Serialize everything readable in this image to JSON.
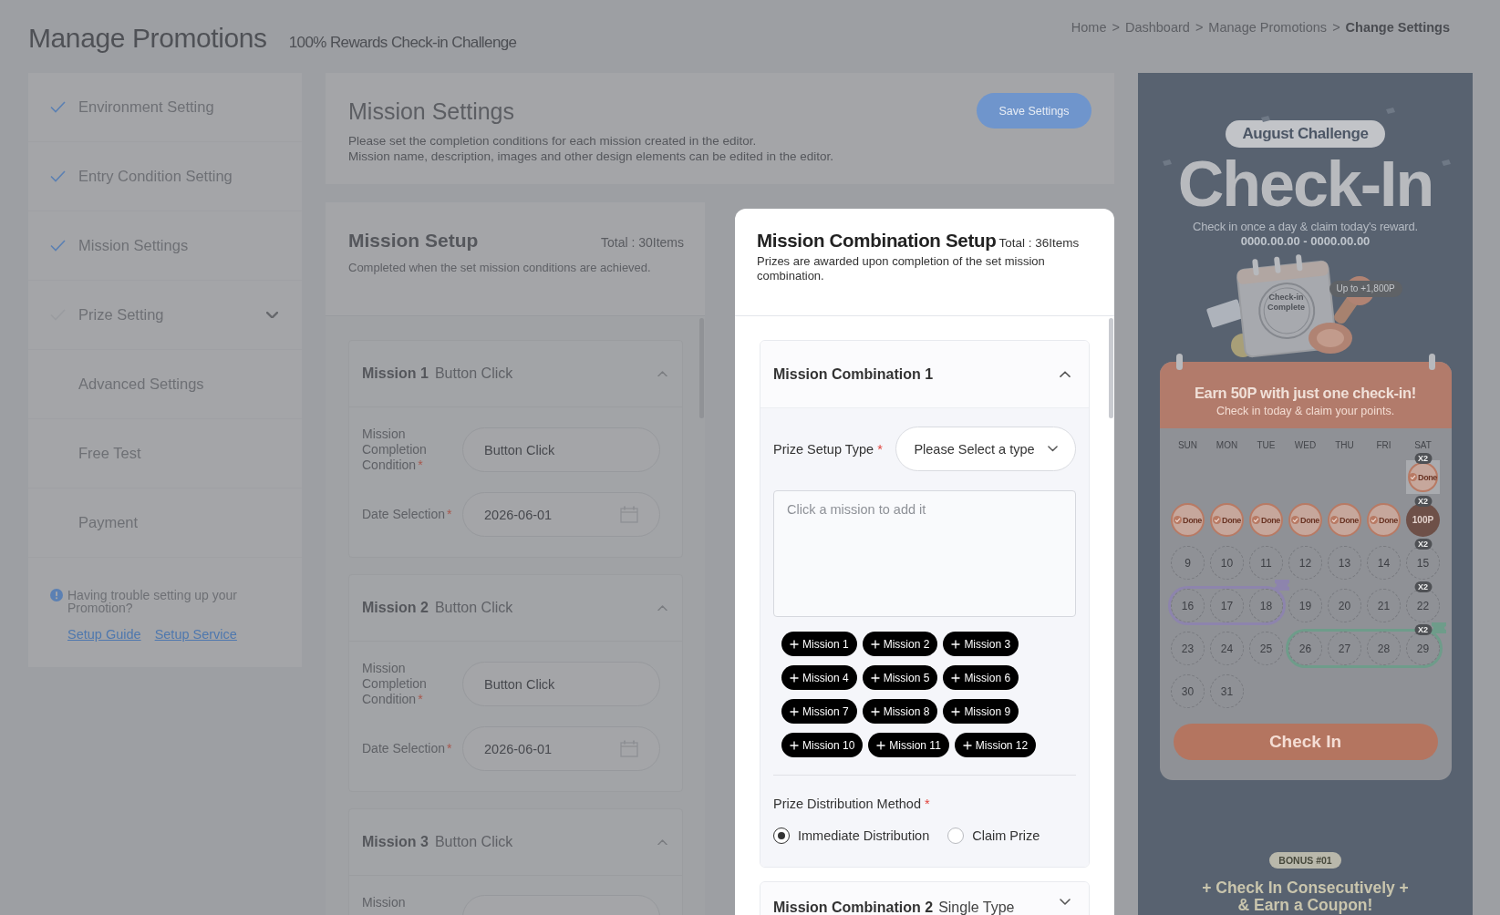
{
  "header": {
    "title": "Manage Promotions",
    "subtitle": "100% Rewards Check-in Challenge",
    "breadcrumb": [
      {
        "label": "Home",
        "kind": "link"
      },
      {
        "label": ">",
        "kind": "separator"
      },
      {
        "label": "Dashboard",
        "kind": "link"
      },
      {
        "label": ">",
        "kind": "separator"
      },
      {
        "label": "Manage Promotions",
        "kind": "link"
      },
      {
        "label": ">",
        "kind": "separator"
      },
      {
        "label": "Change Settings",
        "kind": "current"
      }
    ]
  },
  "sidebar": {
    "items": [
      {
        "label": "Environment Setting",
        "kind": "step",
        "completed": true,
        "in_progress": false
      },
      {
        "label": "Entry Condition Setting",
        "kind": "step",
        "completed": true,
        "in_progress": false
      },
      {
        "label": "Mission Settings",
        "kind": "step",
        "completed": true,
        "in_progress": false
      },
      {
        "label": "Prize Setting",
        "kind": "group",
        "completed": false,
        "in_progress": true,
        "expanded": false
      },
      {
        "label": "Advanced Settings",
        "kind": "step",
        "completed": false,
        "in_progress": false
      },
      {
        "label": "Free Test",
        "kind": "step",
        "completed": false,
        "in_progress": false
      },
      {
        "label": "Payment",
        "kind": "step",
        "completed": false,
        "in_progress": false
      }
    ],
    "help": {
      "text": "Having trouble setting up your Promotion?",
      "links": [
        "Setup Guide",
        "Setup Service"
      ]
    }
  },
  "settings": {
    "title": "Mission Settings",
    "description": [
      "Please set the completion conditions for each mission created in the editor.",
      "Mission name, description, images and other design elements can be edited in the editor."
    ],
    "save_button": "Save Settings"
  },
  "mission_setup": {
    "title": "Mission Setup",
    "total": "Total : 30Items",
    "description": "Completed when the set mission conditions are achieved.",
    "missions": [
      {
        "number": "Mission 1",
        "type": "Button Click",
        "expanded": true,
        "fields": [
          {
            "kind": "text",
            "label": "Mission Completion Condition",
            "required_mark": "*",
            "value": "Button Click"
          },
          {
            "kind": "date",
            "label": "Date Selection",
            "required_mark": "*",
            "value": "2026-06-01"
          }
        ]
      },
      {
        "number": "Mission 2",
        "type": "Button Click",
        "expanded": true,
        "fields": [
          {
            "kind": "text",
            "label": "Mission Completion Condition",
            "required_mark": "*",
            "value": "Button Click"
          },
          {
            "kind": "date",
            "label": "Date Selection",
            "required_mark": "*",
            "value": "2026-06-01"
          }
        ]
      },
      {
        "number": "Mission 3",
        "type": "Button Click",
        "expanded": true,
        "fields": [
          {
            "kind": "text",
            "label": "Mission"
          }
        ]
      }
    ]
  },
  "combination_setup": {
    "title": "Mission Combination Setup",
    "total": "Total : 36Items",
    "description": "Prizes are awarded upon completion of the set mission combination.",
    "combinations": [
      {
        "title": "Mission Combination 1",
        "expanded": true,
        "prize_type": {
          "label": "Prize Setup Type",
          "required_mark": "*",
          "value": "Please Select a type"
        },
        "missions_field": {
          "placeholder": "Click a mission to add it"
        },
        "mission_chips": [
          "Mission 1",
          "Mission 2",
          "Mission 3",
          "Mission 4",
          "Mission 5",
          "Mission 6",
          "Mission 7",
          "Mission 8",
          "Mission 9",
          "Mission 10",
          "Mission 11",
          "Mission 12"
        ],
        "distribution": {
          "label": "Prize Distribution Method",
          "required_mark": "*",
          "options": [
            {
              "label": "Immediate Distribution",
              "selected": true
            },
            {
              "label": "Claim Prize",
              "selected": false
            }
          ]
        }
      },
      {
        "title": "Mission Combination 2",
        "type": "Single Type",
        "expanded": false
      }
    ]
  },
  "preview": {
    "badge": "August Challenge",
    "title": "Check-In",
    "subtitle": "Check in once a day & claim today's reward.",
    "period": "0000.00.00 - 0000.00.00",
    "illustration_text": "Check-in Complete",
    "reward_tag": "Up to +1,800P",
    "calendar": {
      "headline": "Earn 50P with just one check-in!",
      "subline": "Check in today & claim your points.",
      "weekdays": [
        "SUN",
        "MON",
        "TUE",
        "WED",
        "THU",
        "FRI",
        "SAT"
      ],
      "weeks": [
        [
          {
            "kind": "empty"
          },
          {
            "kind": "empty"
          },
          {
            "kind": "empty"
          },
          {
            "kind": "empty"
          },
          {
            "kind": "empty"
          },
          {
            "kind": "empty"
          },
          {
            "kind": "sticker",
            "label": "Done",
            "badge": "X2"
          }
        ],
        [
          {
            "kind": "stamp",
            "label": "Done"
          },
          {
            "kind": "stamp",
            "label": "Done"
          },
          {
            "kind": "stamp",
            "label": "Done"
          },
          {
            "kind": "stamp",
            "label": "Done"
          },
          {
            "kind": "stamp",
            "label": "Done"
          },
          {
            "kind": "stamp",
            "label": "Done"
          },
          {
            "kind": "reward",
            "label": "100P",
            "badge": "X2"
          }
        ],
        [
          {
            "kind": "day",
            "label": "9"
          },
          {
            "kind": "day",
            "label": "10"
          },
          {
            "kind": "day",
            "label": "11"
          },
          {
            "kind": "day",
            "label": "12"
          },
          {
            "kind": "day",
            "label": "13"
          },
          {
            "kind": "day",
            "label": "14"
          },
          {
            "kind": "day",
            "label": "15",
            "badge": "X2"
          }
        ],
        [
          {
            "kind": "day",
            "label": "16",
            "color": "#8d84ad"
          },
          {
            "kind": "day",
            "label": "17",
            "color": "#8d84ad"
          },
          {
            "kind": "day",
            "label": "18",
            "color": "#8d84ad"
          },
          {
            "kind": "day",
            "label": "19"
          },
          {
            "kind": "day",
            "label": "20"
          },
          {
            "kind": "day",
            "label": "21"
          },
          {
            "kind": "day",
            "label": "22",
            "badge": "X2"
          }
        ],
        [
          {
            "kind": "day",
            "label": "23"
          },
          {
            "kind": "day",
            "label": "24"
          },
          {
            "kind": "day",
            "label": "25"
          },
          {
            "kind": "day",
            "label": "26",
            "color": "#6e9c8a"
          },
          {
            "kind": "day",
            "label": "27",
            "color": "#6e9c8a"
          },
          {
            "kind": "day",
            "label": "28",
            "color": "#6e9c8a"
          },
          {
            "kind": "day",
            "label": "29",
            "color": "#6e9c8a",
            "badge": "X2"
          }
        ],
        [
          {
            "kind": "day",
            "label": "30"
          },
          {
            "kind": "day",
            "label": "31"
          },
          {
            "kind": "empty"
          },
          {
            "kind": "empty"
          },
          {
            "kind": "empty"
          },
          {
            "kind": "empty"
          },
          {
            "kind": "empty"
          }
        ]
      ],
      "button": "Check In"
    },
    "bonus": {
      "badge": "BONUS #01",
      "title": "+ Check In Consecutively +",
      "subtitle": "& Earn a Coupon!"
    }
  }
}
